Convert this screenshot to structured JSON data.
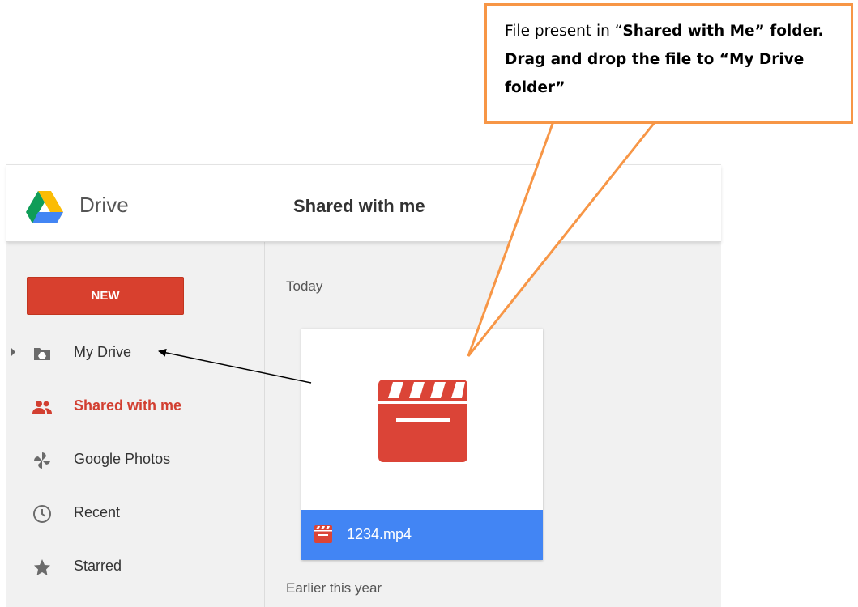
{
  "header": {
    "app_name": "Drive",
    "page_title": "Shared with me"
  },
  "sidebar": {
    "new_label": "NEW",
    "items": [
      {
        "label": "My Drive",
        "icon": "my-drive-folder-icon",
        "active": false
      },
      {
        "label": "Shared with me",
        "icon": "people-icon",
        "active": true
      },
      {
        "label": "Google Photos",
        "icon": "photos-pinwheel-icon",
        "active": false
      },
      {
        "label": "Recent",
        "icon": "clock-icon",
        "active": false
      },
      {
        "label": "Starred",
        "icon": "star-icon",
        "active": false
      }
    ]
  },
  "main": {
    "section_today": "Today",
    "section_earlier": "Earlier this year",
    "file": {
      "name": "1234.mp4",
      "icon": "video-clapperboard-icon"
    }
  },
  "annotation": {
    "text_prefix": "File present in “",
    "text_bold": "Shared with Me” folder. Drag and drop the file to “My Drive folder”"
  },
  "colors": {
    "accent_red": "#d8402e",
    "active_red": "#d23f31",
    "file_footer_blue": "#4285f4",
    "callout_orange": "#f79646",
    "sidebar_bg": "#f1f1f1"
  }
}
